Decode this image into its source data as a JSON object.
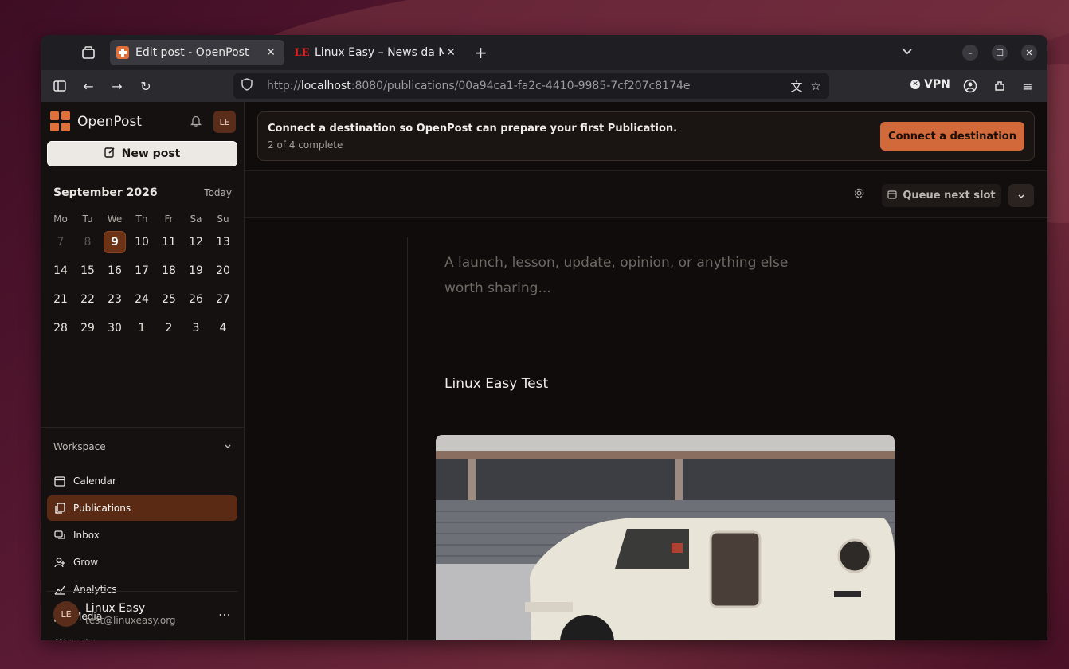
{
  "browser": {
    "tabs": [
      {
        "title": "Edit post - OpenPost",
        "active": true
      },
      {
        "title": "Linux Easy – News da Mor",
        "active": false
      }
    ],
    "url_prefix": "http://",
    "url_host": "localhost",
    "url_rest": ":8080/publications/00a94ca1-fa2c-4410-9985-7cf207c8174e",
    "vpn_label": "VPN"
  },
  "sidebar": {
    "brand": "OpenPost",
    "avatar_initials": "LE",
    "new_post_label": "New post",
    "calendar": {
      "month": "September 2026",
      "today_label": "Today",
      "weekdays": [
        "Mo",
        "Tu",
        "We",
        "Th",
        "Fr",
        "Sa",
        "Su"
      ],
      "weeks": [
        [
          "7",
          "8",
          "9",
          "10",
          "11",
          "12",
          "13"
        ],
        [
          "14",
          "15",
          "16",
          "17",
          "18",
          "19",
          "20"
        ],
        [
          "21",
          "22",
          "23",
          "24",
          "25",
          "26",
          "27"
        ],
        [
          "28",
          "29",
          "30",
          "1",
          "2",
          "3",
          "4"
        ]
      ],
      "selected": "9"
    },
    "workspace_label": "Workspace",
    "nav": [
      {
        "label": "Calendar",
        "icon": "calendar-icon"
      },
      {
        "label": "Publications",
        "icon": "publications-icon",
        "active": true
      },
      {
        "label": "Inbox",
        "icon": "inbox-icon"
      },
      {
        "label": "Grow",
        "icon": "user-plus-icon"
      },
      {
        "label": "Analytics",
        "icon": "analytics-icon"
      },
      {
        "label": "Media",
        "icon": "media-icon"
      },
      {
        "label": "Editors",
        "icon": "editors-icon"
      }
    ],
    "user": {
      "initials": "LE",
      "name": "Linux Easy",
      "email": "test@linuxeasy.org"
    }
  },
  "main": {
    "banner": {
      "text": "Connect a destination so OpenPost can prepare your first Publication.",
      "progress": "2 of 4 complete",
      "button": "Connect a destination"
    },
    "toolbar": {
      "queue_label": "Queue next slot"
    },
    "editor": {
      "placeholder": "A launch, lesson, update, opinion, or anything else worth sharing...",
      "title": "Linux Easy Test"
    }
  },
  "colors": {
    "accent": "#d2693a",
    "active_nav": "#5a2a14"
  }
}
